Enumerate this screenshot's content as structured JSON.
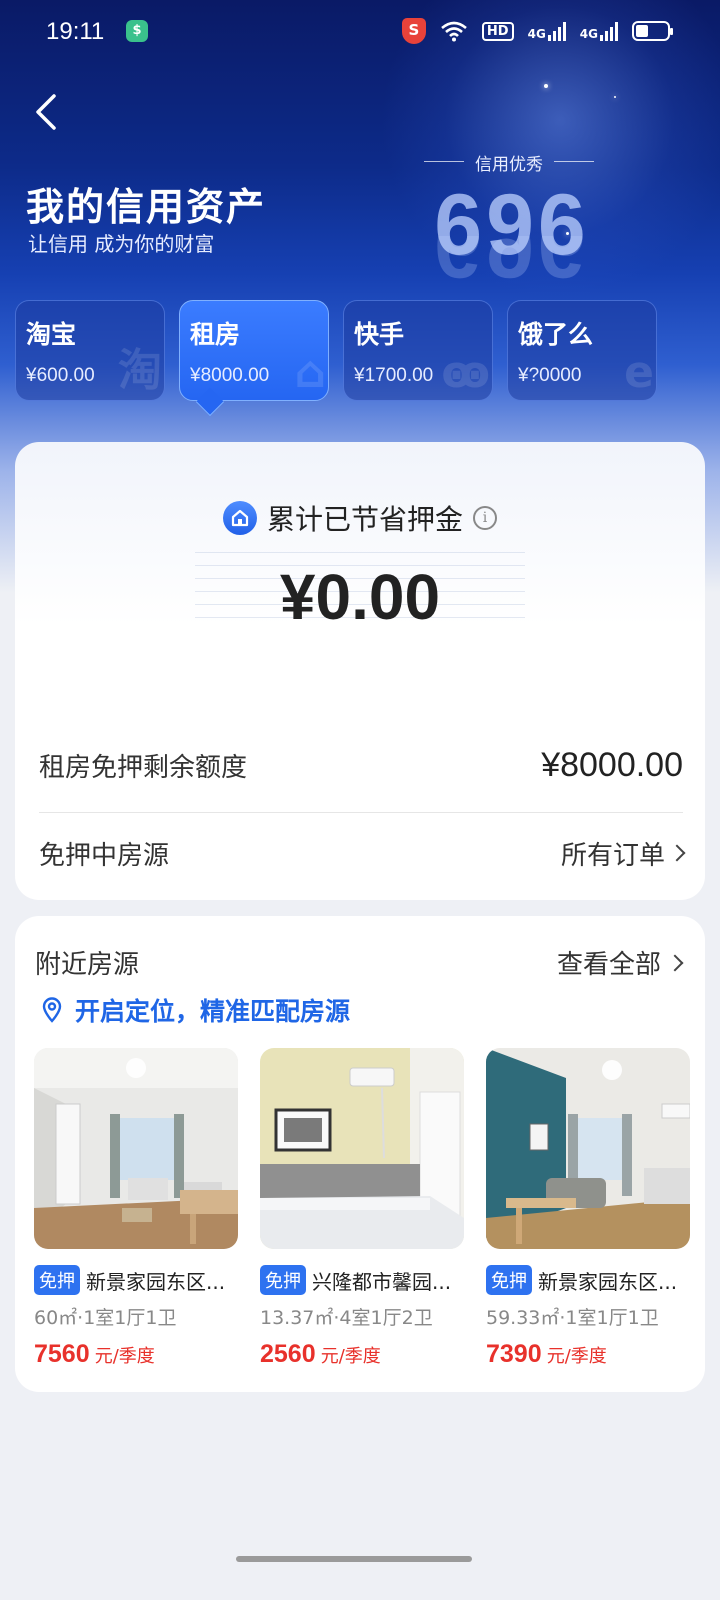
{
  "status_bar": {
    "time": "19:11",
    "net_label_1": "4G",
    "net_label_2": "4G",
    "hd_label": "HD",
    "security_badge": "S",
    "app_badge": "$"
  },
  "header": {
    "back_icon": "chevron-left-icon",
    "title": "我的信用资产",
    "subtitle": "让信用 成为你的财富",
    "credit_label": "信用优秀",
    "credit_score": "696"
  },
  "platforms": [
    {
      "name": "淘宝",
      "amount": "¥600.00",
      "watermark": "淘"
    },
    {
      "name": "租房",
      "amount": "¥8000.00",
      "watermark": "⌂"
    },
    {
      "name": "快手",
      "amount": "¥1700.00",
      "watermark": "ꙭ"
    },
    {
      "name": "饿了么",
      "amount": "¥?0000",
      "watermark": "e"
    }
  ],
  "savings": {
    "title": "累计已节省押金",
    "amount": "¥0.00",
    "info_icon": "info-icon",
    "remaining_label": "租房免押剩余额度",
    "remaining_value": "¥8000.00",
    "active_label": "免押中房源",
    "orders_link": "所有订单"
  },
  "nearby": {
    "title": "附近房源",
    "view_all": "查看全部",
    "location_prompt": "开启定位，精准匹配房源",
    "houses": [
      {
        "tag": "免押",
        "name": "新景家园东区...",
        "spec": "60㎡·1室1厅1卫",
        "price": "7560",
        "unit": "元/季度"
      },
      {
        "tag": "免押",
        "name": "兴隆都市馨园...",
        "spec": "13.37㎡·4室1厅2卫",
        "price": "2560",
        "unit": "元/季度"
      },
      {
        "tag": "免押",
        "name": "新景家园东区...",
        "spec": "59.33㎡·1室1厅1卫",
        "price": "7390",
        "unit": "元/季度"
      }
    ]
  },
  "colors": {
    "accent_blue": "#2e72f0",
    "price_red": "#e8312b",
    "hero_dark": "#0a1a66"
  }
}
